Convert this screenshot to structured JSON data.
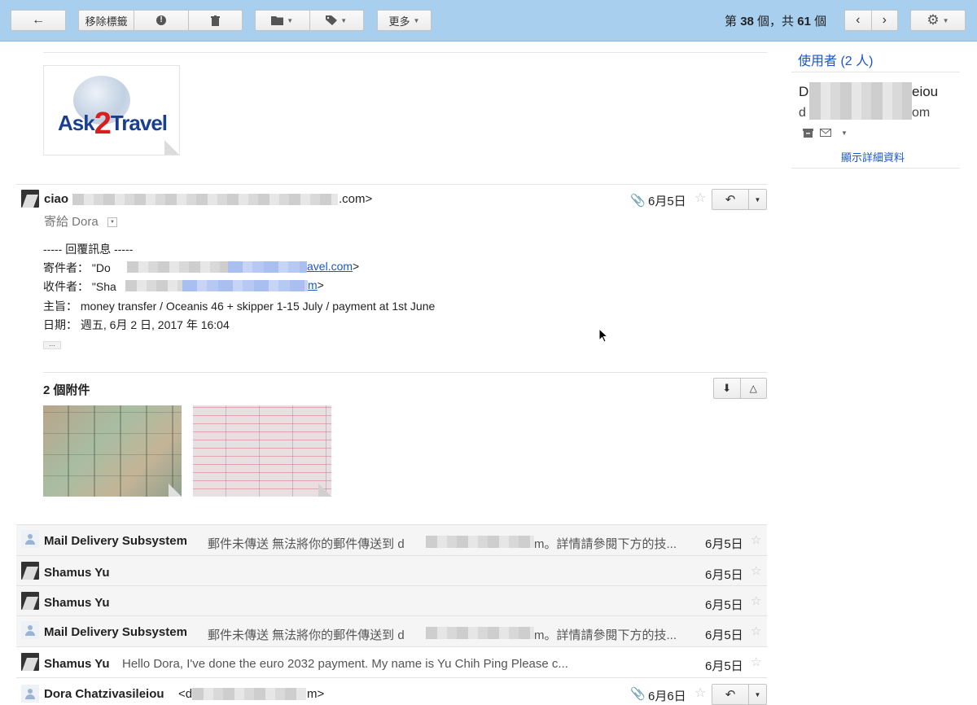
{
  "toolbar": {
    "back_icon": "arrow-left-icon",
    "remove_label": "移除標籤",
    "spam_icon": "report-spam-icon",
    "delete_icon": "trash-icon",
    "folder_icon": "folder-icon",
    "label_icon": "tag-icon",
    "more_label": "更多",
    "pager_prefix": "第",
    "pager_current": "38",
    "pager_mid": "個，共",
    "pager_total": "61",
    "pager_suffix": "個",
    "settings_icon": "gear-icon"
  },
  "logo_text": {
    "ask": "Ask",
    "two": "2",
    "travel": "Travel"
  },
  "open_message": {
    "sender_visible_start": "ciao",
    "sender_visible_end": ".com>",
    "to_label": "寄給 Dora",
    "date": "6月5日",
    "body": {
      "separator": "----- 回覆訊息 -----",
      "from_label": "寄件者：",
      "from_start": "\"Do",
      "from_link_end": "avel.com",
      "from_close": ">",
      "to_label": "收件者：",
      "to_start": "\"Sha",
      "to_link_end": "m",
      "to_close": ">",
      "subject_label": "主旨：",
      "subject": "money transfer / Oceanis 46 + skipper 1-15 July / payment at 1st June",
      "date_label": "日期：",
      "date_value": "週五, 6月 2 日, 2017 年 16:04",
      "more_dots": "..."
    },
    "attachments_title": "2 個附件"
  },
  "thread_rows": [
    {
      "name": "Mail Delivery Subsystem",
      "snippet_start": "郵件未傳送 無法將你的郵件傳送到 d",
      "snippet_end": "m。詳情請參閱下方的技...",
      "date": "6月5日"
    },
    {
      "name": "Shamus Yu",
      "snippet_start": "",
      "snippet_end": "",
      "date": "6月5日"
    },
    {
      "name": "Shamus Yu",
      "snippet_start": "",
      "snippet_end": "",
      "date": "6月5日"
    },
    {
      "name": "Mail Delivery Subsystem",
      "snippet_start": "郵件未傳送 無法將你的郵件傳送到 d",
      "snippet_end": "m。詳情請參閱下方的技...",
      "date": "6月5日"
    },
    {
      "name": "Shamus Yu",
      "snippet_start": "Hello Dora, I've done the euro 2032 payment. My name is Yu Chih Ping Please c...",
      "snippet_end": "",
      "date": "6月5日"
    }
  ],
  "last_row": {
    "name": "Dora Chatzivasileiou",
    "email_start": "<d",
    "email_end": "m>",
    "date": "6月6日"
  },
  "sidebar": {
    "people_title": "使用者 (2 人)",
    "person_name_start": "D",
    "person_name_end": "eiou",
    "person_email_start": "d",
    "person_email_end": "om",
    "details_link": "顯示詳細資料"
  }
}
